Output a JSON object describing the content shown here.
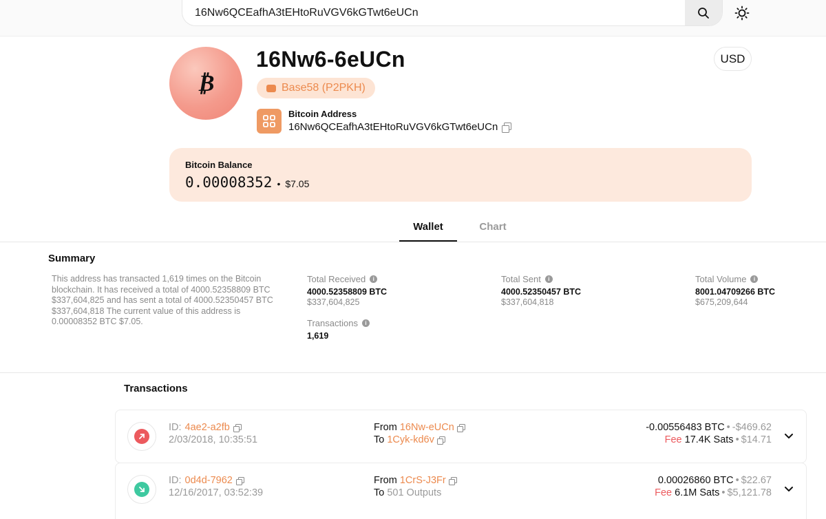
{
  "search": {
    "value": "16Nw6QCEafhA3tEHtoRuVGV6kGTwt6eUCn"
  },
  "header": {
    "avatar_symbol": "₿",
    "short_address": "16Nw6-6eUCn",
    "address_type": "Base58 (P2PKH)",
    "full_address_label": "Bitcoin Address",
    "full_address": "16Nw6QCEafhA3tEHtoRuVGV6kGTwt6eUCn",
    "currency": "USD"
  },
  "balance": {
    "label": "Bitcoin Balance",
    "btc": "0.00008352",
    "separator": "•",
    "usd": "$7.05"
  },
  "tabs": [
    {
      "label": "Wallet",
      "active": true
    },
    {
      "label": "Chart",
      "active": false
    }
  ],
  "summary": {
    "title": "Summary",
    "text": "This address has transacted 1,619 times on the Bitcoin blockchain. It has received a total of 4000.52358809 BTC $337,604,825 and has sent a total of 4000.52350457 BTC $337,604,818 The current value of this address is 0.00008352 BTC $7.05.",
    "stats": {
      "received": {
        "label": "Total Received",
        "btc": "4000.52358809 BTC",
        "usd": "$337,604,825"
      },
      "sent": {
        "label": "Total Sent",
        "btc": "4000.52350457 BTC",
        "usd": "$337,604,818"
      },
      "volume": {
        "label": "Total Volume",
        "btc": "8001.04709266 BTC",
        "usd": "$675,209,644"
      },
      "transactions": {
        "label": "Transactions",
        "value": "1,619"
      }
    }
  },
  "transactions": {
    "title": "Transactions",
    "items": [
      {
        "direction": "out",
        "id_label": "ID:",
        "id": "4ae2-a2fb",
        "date": "2/03/2018, 10:35:51",
        "from_label": "From",
        "from": "16Nw-eUCn",
        "to_label": "To",
        "to": "1Cyk-kd6v",
        "amount_btc": "-0.00556483 BTC",
        "amount_usd": "-$469.62",
        "fee_label": "Fee",
        "fee_sats": "17.4K Sats",
        "fee_usd": "$14.71"
      },
      {
        "direction": "in",
        "id_label": "ID:",
        "id": "0d4d-7962",
        "date": "12/16/2017, 03:52:39",
        "from_label": "From",
        "from": "1CrS-J3Fr",
        "to_label": "To",
        "to": "501 Outputs",
        "amount_btc": "0.00026860 BTC",
        "amount_usd": "$22.67",
        "fee_label": "Fee",
        "fee_sats": "6.1M Sats",
        "fee_usd": "$5,121.78"
      }
    ]
  },
  "colors": {
    "accent": "#ec8a4e",
    "negative": "#ec5a5e",
    "positive": "#3ec9a0",
    "balance_bg": "#fde9dd"
  },
  "icons": [
    "search-icon",
    "sun-icon",
    "wallet-icon",
    "qr-code-icon",
    "copy-icon",
    "info-icon",
    "arrow-up-right-icon",
    "arrow-down-right-icon",
    "chevron-down-icon"
  ]
}
